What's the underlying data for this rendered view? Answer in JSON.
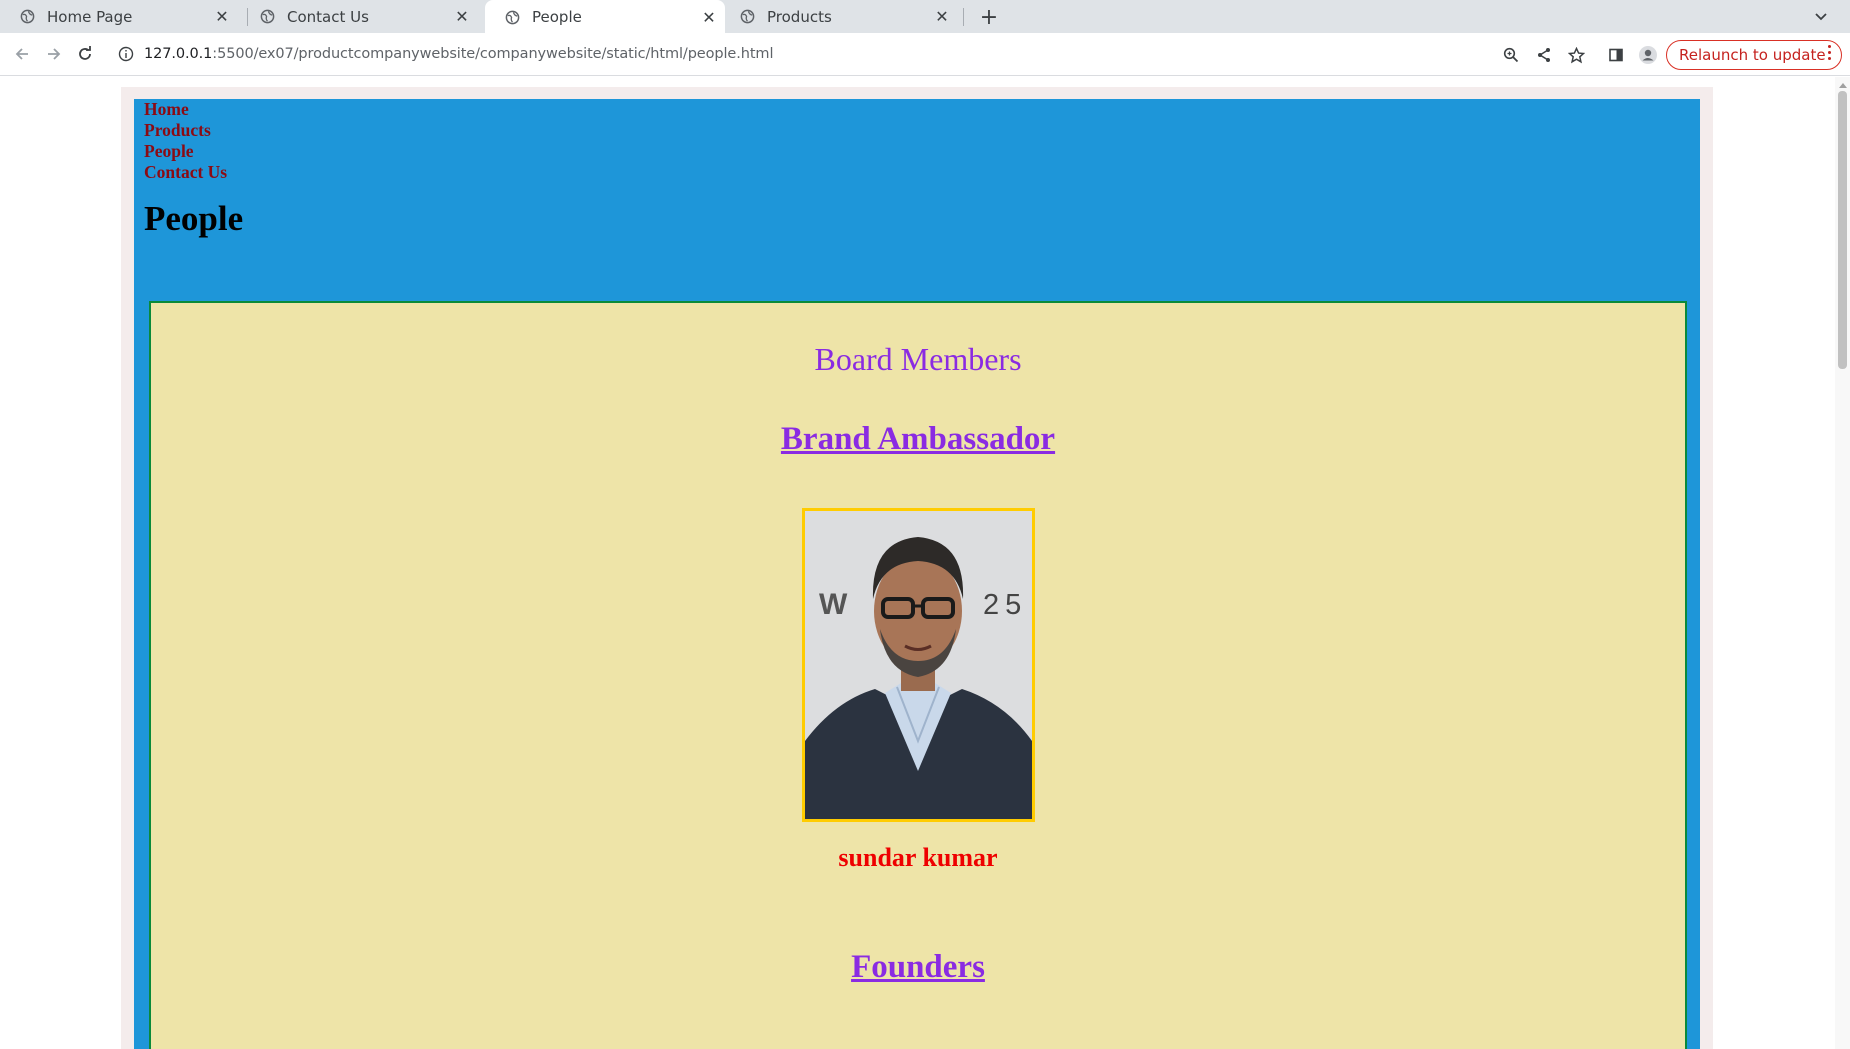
{
  "browser": {
    "tabs": [
      {
        "title": "Home Page",
        "active": false
      },
      {
        "title": "Contact Us",
        "active": false
      },
      {
        "title": "People",
        "active": true
      },
      {
        "title": "Products",
        "active": false
      }
    ],
    "url_host": "127.0.0.1",
    "url_rest": ":5500/ex07/productcompanywebsite/companywebsite/static/html/people.html",
    "relaunch_label": "Relaunch to update",
    "colors": {
      "relaunch": "#c5221f",
      "tabbar": "#dfe3e7"
    }
  },
  "page": {
    "nav": [
      "Home",
      "Products",
      "People",
      "Contact Us"
    ],
    "heading": "People",
    "board_title": "Board Members",
    "ambassador_title": "Brand Ambassador",
    "person_name": "sundar kumar",
    "founders_title": "Founders",
    "colors": {
      "header_bg": "#1e96d9",
      "content_bg": "#eee4a8",
      "link_color": "#8b0b14",
      "section_title": "#8a2be2",
      "name_color": "#ee0000",
      "photo_border": "#ffcc00"
    }
  }
}
